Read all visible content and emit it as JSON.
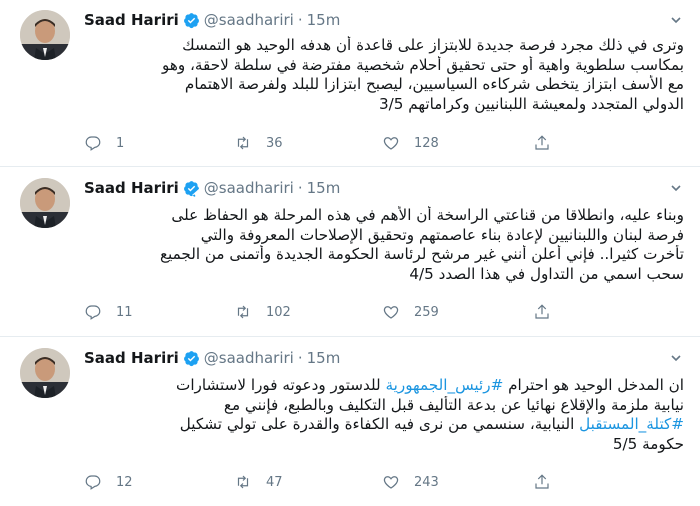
{
  "author": {
    "name": "Saad Hariri",
    "handle": "@saadhariri",
    "separator": "·",
    "time": "15m"
  },
  "colors": {
    "verified": "#1da1f2",
    "link": "#1b95e0",
    "muted": "#657786",
    "text": "#14171a"
  },
  "icons": [
    "verified-badge-icon",
    "chevron-down-icon",
    "reply-icon",
    "retweet-icon",
    "like-icon",
    "share-icon"
  ],
  "tweets": [
    {
      "lines": [
        "وترى في ذلك مجرد فرصة جديدة للابتزاز على قاعدة أن هدفه الوحيد هو التمسك",
        "بمكاسب سلطوية واهية أو حتى تحقيق أحلام شخصية مفترضة في سلطة لاحقة، وهو",
        "مع الأسف ابتزاز يتخطى شركاءه السياسيين، ليصبح ابتزازا للبلد ولفرصة الاهتمام",
        "الدولي المتجدد ولمعيشة اللبنانيين وكراماتهم 3/5"
      ],
      "replies": "1",
      "retweets": "36",
      "likes": "128"
    },
    {
      "lines": [
        "وبناء عليه، وانطلاقا من قناعتي الراسخة أن الأهم في هذه المرحلة هو الحفاظ على",
        "فرصة لبنان واللبنانيين لإعادة بناء عاصمتهم وتحقيق الإصلاحات المعروفة والتي",
        "تأخرت كثيرا.. فإني أعلن أنني غير مرشح لرئاسة الحكومة الجديدة وأتمنى من الجميع",
        "سحب اسمي من التداول في هذا الصدد 4/5"
      ],
      "replies": "11",
      "retweets": "102",
      "likes": "259"
    },
    {
      "line1_a": "ان المدخل الوحيد هو احترام ",
      "line1_tag": "#رئيس_الجمهورية",
      "line1_b": " للدستور ودعوته فورا لاستشارات",
      "line2": "نيابية ملزمة والإقلاع نهائيا عن بدعة التأليف قبل التكليف وبالطبع، فإنني مع",
      "line3_tag": "#كتلة_المستقبل",
      "line3_b": " النيابية، سنسمي من نرى فيه الكفاءة والقدرة على تولي تشكيل",
      "line4": "حكومة 5/5",
      "replies": "12",
      "retweets": "47",
      "likes": "243"
    }
  ]
}
